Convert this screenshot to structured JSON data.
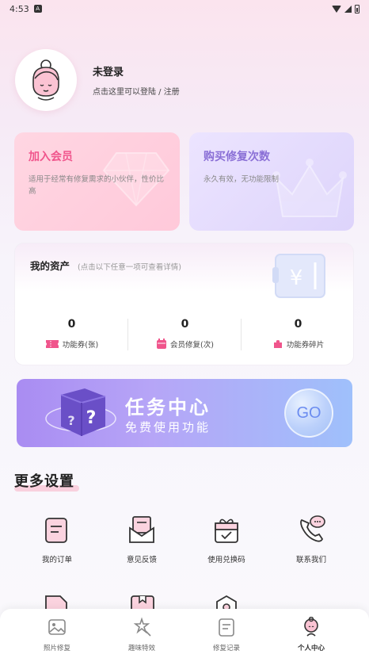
{
  "status": {
    "time": "4:53"
  },
  "profile": {
    "title": "未登录",
    "subtitle": "点击这里可以登陆 / 注册"
  },
  "cards": {
    "member": {
      "title": "加入会员",
      "desc": "适用于经常有修复需求的小伙伴，性价比高"
    },
    "buy": {
      "title": "购买修复次数",
      "desc": "永久有效，无功能限制"
    }
  },
  "assets": {
    "title": "我的资产",
    "hint": "(点击以下任意一项可查看详情)",
    "stats": [
      {
        "value": "0",
        "label": "功能券(张)"
      },
      {
        "value": "0",
        "label": "会员修复(次)"
      },
      {
        "value": "0",
        "label": "功能券碎片"
      }
    ]
  },
  "task": {
    "title": "任务中心",
    "subtitle": "免费使用功能",
    "go": "GO"
  },
  "more": {
    "title": "更多设置",
    "items": [
      {
        "label": "我的订单",
        "icon": "order-icon"
      },
      {
        "label": "意见反馈",
        "icon": "feedback-icon"
      },
      {
        "label": "使用兑换码",
        "icon": "gift-code-icon"
      },
      {
        "label": "联系我们",
        "icon": "phone-icon"
      }
    ]
  },
  "nav": {
    "items": [
      {
        "label": "照片修复",
        "icon": "photo-icon"
      },
      {
        "label": "趣味特效",
        "icon": "magic-icon"
      },
      {
        "label": "修复记录",
        "icon": "record-icon"
      },
      {
        "label": "个人中心",
        "icon": "profile-icon",
        "active": true
      }
    ]
  },
  "colors": {
    "accent_pink": "#f0558c",
    "accent_purple": "#8a6fd6"
  }
}
